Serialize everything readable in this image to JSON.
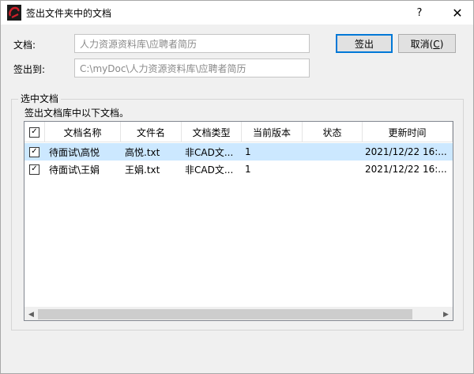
{
  "window": {
    "title": "签出文件夹中的文档",
    "help_glyph": "?",
    "close_glyph": "✕"
  },
  "form": {
    "doc_label": "文档:",
    "doc_value": "人力资源资料库\\应聘者简历",
    "checkout_to_label": "签出到:",
    "checkout_to_value": "C:\\myDoc\\人力资源资料库\\应聘者简历"
  },
  "buttons": {
    "checkout": "签出",
    "cancel_text": "取消(",
    "cancel_accel": "C",
    "cancel_close": ")"
  },
  "group": {
    "title": "选中文档",
    "description": "签出文档库中以下文档。"
  },
  "table": {
    "headers": [
      "文档名称",
      "文件名",
      "文档类型",
      "当前版本",
      "状态",
      "更新时间"
    ],
    "rows": [
      {
        "checked": true,
        "doc_name": "待面试\\高悦",
        "file_name": "高悦.txt",
        "doc_type": "非CAD文...",
        "version": "1",
        "status": "",
        "updated": "2021/12/22 16:..."
      },
      {
        "checked": true,
        "doc_name": "待面试\\王娟",
        "file_name": "王娟.txt",
        "doc_type": "非CAD文...",
        "version": "1",
        "status": "",
        "updated": "2021/12/22 16:..."
      }
    ]
  },
  "scrollbar": {
    "left_glyph": "◀",
    "right_glyph": "▶"
  },
  "colors": {
    "selected_row": "#cce8ff",
    "default_button_border": "#0078d7",
    "window_bg": "#f0f0f0"
  }
}
